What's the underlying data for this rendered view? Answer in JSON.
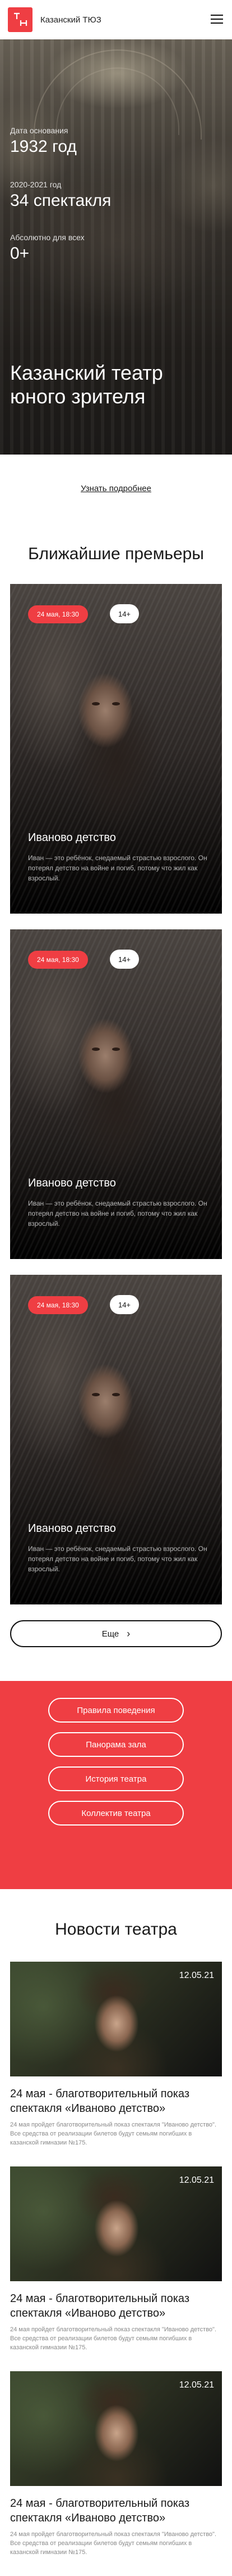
{
  "header": {
    "title": "Казанский ТЮЗ"
  },
  "hero": {
    "stats": [
      {
        "label": "Дата основания",
        "value": "1932 год"
      },
      {
        "label": "2020-2021 год",
        "value": "34 спектакля"
      },
      {
        "label": "Абсолютно для всех",
        "value": "0+"
      }
    ],
    "heading_line1": "Казанский театр",
    "heading_line2": "юного зрителя"
  },
  "learn_more": "Узнать подробнее",
  "premieres": {
    "title": "Ближайшие премьеры",
    "cards": [
      {
        "date": "24 мая, 18:30",
        "age": "14+",
        "name": "Иваново детство",
        "desc": "Иван — это ребёнок, снедаемый страстью взрослого. Он потерял детство на войне и погиб, потому что жил как взрослый."
      },
      {
        "date": "24 мая, 18:30",
        "age": "14+",
        "name": "Иваново детство",
        "desc": "Иван — это ребёнок, снедаемый страстью взрослого. Он потерял детство на войне и погиб, потому что жил как взрослый."
      },
      {
        "date": "24 мая, 18:30",
        "age": "14+",
        "name": "Иваново детство",
        "desc": "Иван — это ребёнок, снедаемый страстью взрослого. Он потерял детство на войне и погиб, потому что жил как взрослый."
      }
    ],
    "more_label": "Еще",
    "more_arrow": "›"
  },
  "links": [
    "Правила поведения",
    "Панорама зала",
    "История театра",
    "Коллектив театра"
  ],
  "news": {
    "title": "Новости театра",
    "items": [
      {
        "date": "12.05.21",
        "title": "24 мая - благотворительный показ спектакля «Иваново детство»",
        "text": "24 мая пройдет благотворительный показ спектакля \"Иваново детство\". Все средства от реализации билетов будут семьям погибших в казанской гимназии №175."
      },
      {
        "date": "12.05.21",
        "title": "24 мая - благотворительный показ спектакля «Иваново детство»",
        "text": "24 мая пройдет благотворительный показ спектакля \"Иваново детство\". Все средства от реализации билетов будут семьям погибших в казанской гимназии №175."
      },
      {
        "date": "12.05.21",
        "title": "24 мая - благотворительный показ спектакля «Иваново детство»",
        "text": "24 мая пройдет благотворительный показ спектакля \"Иваново детство\". Все средства от реализации билетов будут семьям погибших в казанской гимназии №175."
      }
    ]
  }
}
